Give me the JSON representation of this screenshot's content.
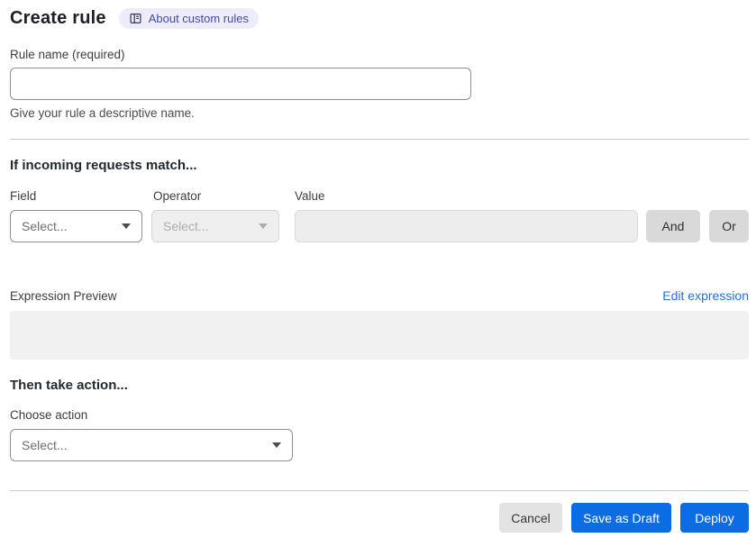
{
  "header": {
    "title": "Create rule",
    "about_badge": {
      "label": "About custom rules",
      "icon": "book-icon"
    }
  },
  "rule_name": {
    "label": "Rule name (required)",
    "value": "",
    "helper": "Give your rule a descriptive name."
  },
  "match_section": {
    "heading": "If incoming requests match...",
    "field": {
      "label": "Field",
      "selected": "Select...",
      "enabled": true
    },
    "operator": {
      "label": "Operator",
      "selected": "Select...",
      "enabled": false
    },
    "value": {
      "label": "Value",
      "value": "",
      "enabled": false
    },
    "and_button": "And",
    "or_button": "Or",
    "expression_preview_label": "Expression Preview",
    "edit_expression_link": "Edit expression",
    "expression_value": ""
  },
  "action_section": {
    "heading": "Then take action...",
    "choose_action_label": "Choose action",
    "action": {
      "selected": "Select...",
      "enabled": true
    }
  },
  "footer": {
    "cancel_label": "Cancel",
    "save_draft_label": "Save as Draft",
    "deploy_label": "Deploy"
  },
  "colors": {
    "primary_blue": "#0b6ce4",
    "link_blue": "#2570dc",
    "badge_bg": "#edecfa",
    "badge_text": "#4449ab",
    "disabled_bg": "#efefef",
    "preview_box_bg": "#f1f1f1",
    "divider": "#c9c9c9"
  }
}
